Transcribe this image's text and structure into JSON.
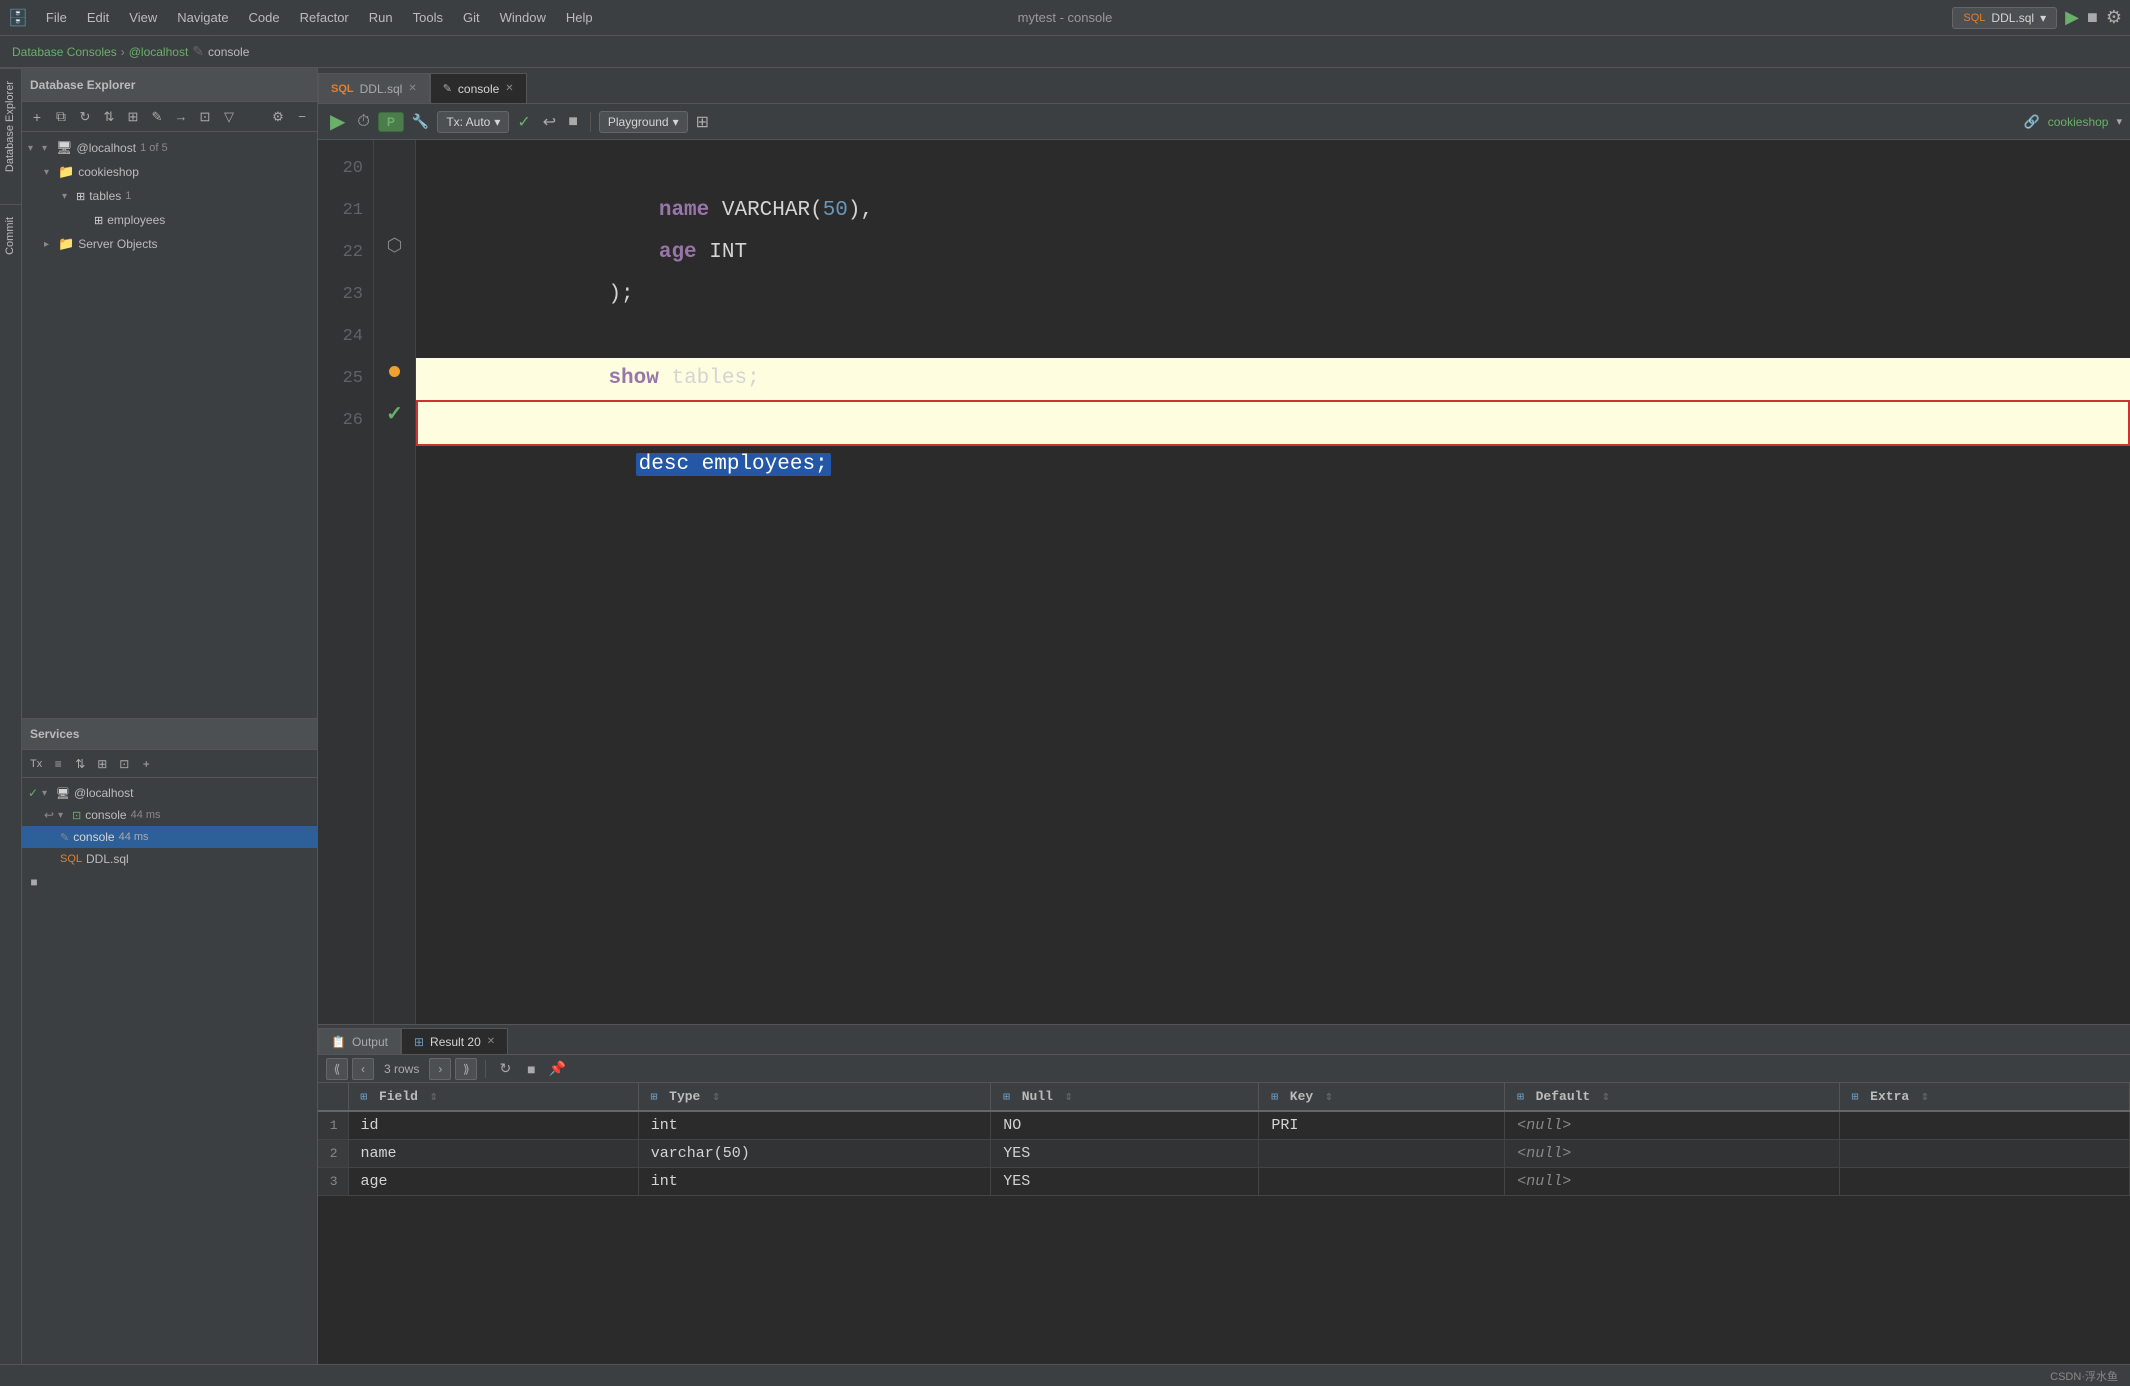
{
  "app": {
    "title": "mytest - console",
    "icon": "🗄️"
  },
  "menubar": {
    "items": [
      "File",
      "Edit",
      "View",
      "Navigate",
      "Code",
      "Refactor",
      "Run",
      "Tools",
      "Git",
      "Window",
      "Help"
    ]
  },
  "breadcrumb": {
    "items": [
      "Database Consoles",
      "@localhost",
      "console"
    ]
  },
  "ddl_dropdown": {
    "label": "DDL.sql",
    "icon": "▾"
  },
  "tabs": {
    "items": [
      {
        "label": "DDL.sql",
        "icon": "SQL",
        "active": false,
        "closable": true
      },
      {
        "label": "console",
        "icon": "✎",
        "active": true,
        "closable": true
      }
    ]
  },
  "toolbar": {
    "run_label": "▶",
    "timer_label": "⏱",
    "profiler_label": "P",
    "wrench_label": "🔧",
    "tx_label": "Tx: Auto",
    "check_label": "✓",
    "undo_label": "↩",
    "stop_label": "■",
    "playground_label": "Playground",
    "table_label": "⊞",
    "schema_label": "cookieshop",
    "schema_icon": "🔗"
  },
  "editor": {
    "lines": [
      {
        "num": "20",
        "content": "    name VARCHAR(50),",
        "parts": [
          {
            "text": "    "
          },
          {
            "text": "name",
            "type": "kw"
          },
          {
            "text": " VARCHAR(",
            "type": "id"
          },
          {
            "text": "50",
            "type": "num"
          },
          {
            "text": "),",
            "type": "id"
          }
        ]
      },
      {
        "num": "21",
        "content": "    age INT",
        "parts": [
          {
            "text": "    "
          },
          {
            "text": "age",
            "type": "kw"
          },
          {
            "text": " INT",
            "type": "id"
          }
        ]
      },
      {
        "num": "22",
        "content": ");",
        "highlighted": false
      },
      {
        "num": "23",
        "content": ""
      },
      {
        "num": "24",
        "content": "show tables;"
      },
      {
        "num": "25",
        "content": "",
        "has_dot": true
      },
      {
        "num": "26",
        "content": "desc employees;",
        "executing": true,
        "has_check": true
      }
    ]
  },
  "results": {
    "tabs": [
      {
        "label": "Output",
        "icon": "📋",
        "active": false
      },
      {
        "label": "Result 20",
        "icon": "⊞",
        "active": true,
        "closable": true
      }
    ],
    "rows_info": "3 rows",
    "columns": [
      {
        "label": "Field",
        "icon": "⊞"
      },
      {
        "label": "Type",
        "icon": "⊞"
      },
      {
        "label": "Null",
        "icon": "⊞"
      },
      {
        "label": "Key",
        "icon": "⊞"
      },
      {
        "label": "Default",
        "icon": "⊞"
      },
      {
        "label": "Extra",
        "icon": "⊞"
      }
    ],
    "rows": [
      {
        "num": "1",
        "field": "id",
        "type": "int",
        "null": "NO",
        "key": "PRI",
        "default": "<null>",
        "extra": ""
      },
      {
        "num": "2",
        "field": "name",
        "type": "varchar(50)",
        "null": "YES",
        "key": "",
        "default": "<null>",
        "extra": ""
      },
      {
        "num": "3",
        "field": "age",
        "type": "int",
        "null": "YES",
        "key": "",
        "default": "<null>",
        "extra": ""
      }
    ]
  },
  "database_explorer": {
    "title": "Database Explorer",
    "tree": [
      {
        "label": "@localhost",
        "badge": "1 of 5",
        "level": 0,
        "expanded": true,
        "icon": "🖥"
      },
      {
        "label": "cookieshop",
        "level": 1,
        "expanded": true,
        "icon": "📁"
      },
      {
        "label": "tables",
        "badge": "1",
        "level": 2,
        "expanded": true,
        "icon": "📋"
      },
      {
        "label": "employees",
        "level": 3,
        "icon": "📋"
      },
      {
        "label": "Server Objects",
        "level": 1,
        "icon": "📁"
      }
    ]
  },
  "services": {
    "title": "Services",
    "tree": [
      {
        "label": "@localhost",
        "level": 0,
        "icon": "🖥",
        "has_check": true,
        "expanded": true
      },
      {
        "label": "console",
        "badge": "44 ms",
        "level": 1,
        "icon": "📁",
        "expanded": true
      },
      {
        "label": "console",
        "badge": "44 ms",
        "level": 2,
        "icon": "✎",
        "selected": true
      },
      {
        "label": "DDL.sql",
        "level": 2,
        "icon": "SQL"
      }
    ]
  },
  "side_tabs": {
    "items": [
      "Database Explorer",
      "Commit"
    ]
  },
  "status_bar": {
    "right_text": "CSDN·浮水鱼"
  }
}
